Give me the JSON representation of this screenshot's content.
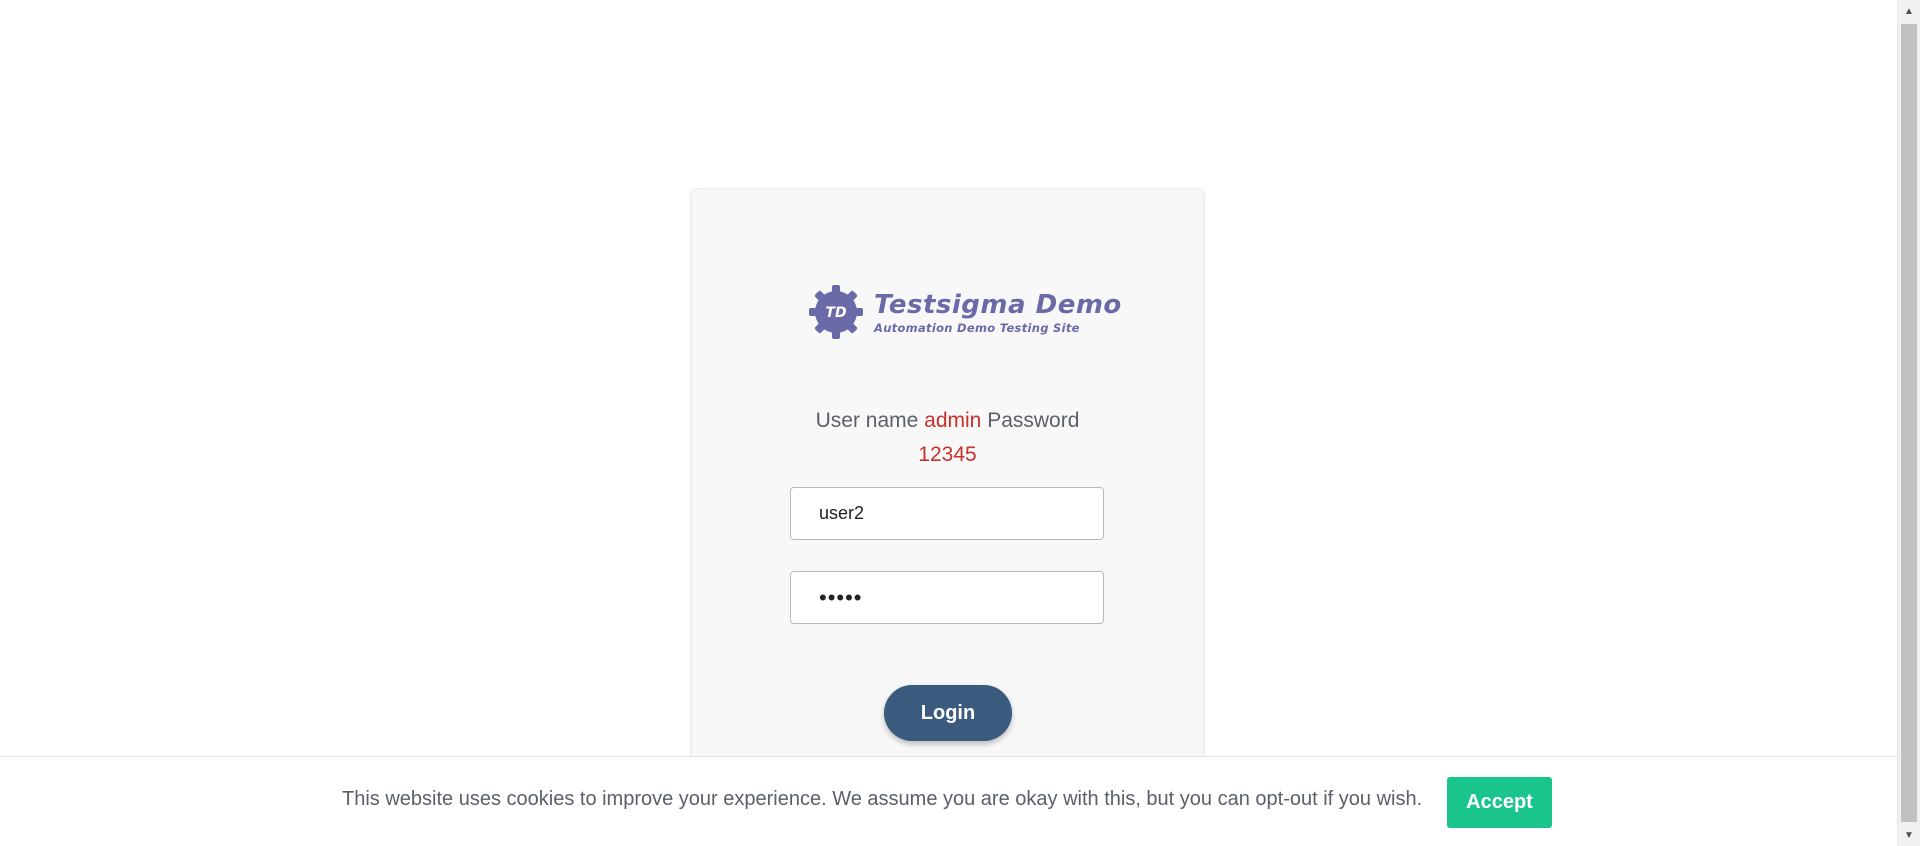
{
  "logo": {
    "badge_text": "TD",
    "title": "Testsigma Demo",
    "subtitle": "Automation Demo Testing Site",
    "color": "#6a6aa8"
  },
  "credentials": {
    "username_label": "User name",
    "username_value": "admin",
    "password_label": "Password",
    "password_value": "12345",
    "highlight_color": "#c9302c"
  },
  "form": {
    "username_value": "user2",
    "password_value": "12345",
    "login_label": "Login"
  },
  "cookie_banner": {
    "message": "This website uses cookies to improve your experience. We assume you are okay with this, but you can opt-out if you wish.",
    "accept_label": "Accept",
    "accept_color": "#1ac48d"
  },
  "scrollbar": {
    "up_icon": "triangle-up-icon",
    "down_icon": "triangle-down-icon"
  }
}
